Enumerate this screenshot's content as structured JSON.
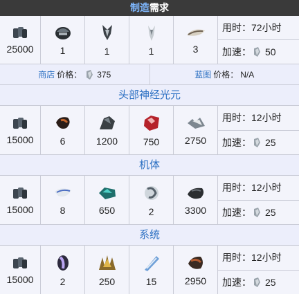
{
  "header": {
    "title_link": "制造",
    "title_rest": "需求"
  },
  "main_recipe": {
    "costs": [
      "25000",
      "1",
      "1",
      "1",
      "3"
    ],
    "build_time_label": "用时：",
    "build_time_value": "72小时",
    "rush_label": "加速：",
    "rush_value": "50"
  },
  "price_row": {
    "market_link": "商店",
    "market_label": "价格：",
    "market_value": "375",
    "blueprint_link": "蓝图",
    "blueprint_label": "价格：",
    "blueprint_value": "N/A"
  },
  "components": [
    {
      "name": "头部神经光元",
      "costs": [
        "15000",
        "6",
        "1200",
        "750",
        "2750"
      ],
      "build_time_label": "用时：",
      "build_time_value": "12小时",
      "rush_label": "加速：",
      "rush_value": "25"
    },
    {
      "name": "机体",
      "costs": [
        "15000",
        "8",
        "650",
        "2",
        "3300"
      ],
      "build_time_label": "用时：",
      "build_time_value": "12小时",
      "rush_label": "加速：",
      "rush_value": "25"
    },
    {
      "name": "系统",
      "costs": [
        "15000",
        "2",
        "250",
        "15",
        "2950"
      ],
      "build_time_label": "用时：",
      "build_time_value": "12小时",
      "rush_label": "加速：",
      "rush_value": "25"
    }
  ]
}
